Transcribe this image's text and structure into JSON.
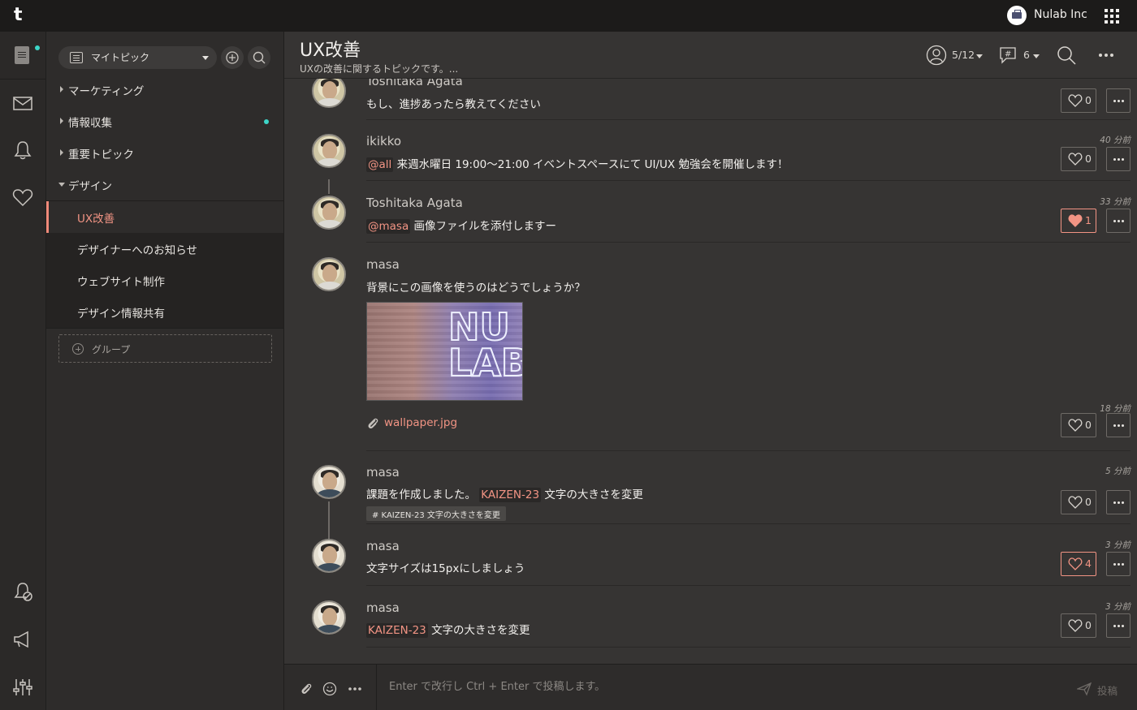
{
  "topbar": {
    "logo": "t",
    "org_name": "Nulab Inc"
  },
  "sidebar": {
    "topic_filter": "マイトピック",
    "groups": [
      {
        "label": "マーケティング",
        "expanded": false,
        "unread": false
      },
      {
        "label": "情報収集",
        "expanded": false,
        "unread": true
      },
      {
        "label": "重要トピック",
        "expanded": false,
        "unread": false
      },
      {
        "label": "デザイン",
        "expanded": true,
        "unread": false
      }
    ],
    "design_topics": [
      {
        "label": "UX改善",
        "active": true
      },
      {
        "label": "デザイナーへのお知らせ",
        "active": false
      },
      {
        "label": "ウェブサイト制作",
        "active": false
      },
      {
        "label": "デザイン情報共有",
        "active": false
      }
    ],
    "add_group": "グループ"
  },
  "header": {
    "title": "UX改善",
    "description": "UXの改善に関するトピックです。...",
    "members": "5/12",
    "tags": "6"
  },
  "messages": [
    {
      "author": "Toshitaka Agata",
      "text": "もし、進捗あったら教えてください",
      "likes": "0",
      "liked": false
    },
    {
      "author": "ikikko",
      "time": "40 分前",
      "mention": "@all",
      "text": "来週水曜日 19:00〜21:00 イベントスペースにて UI/UX 勉強会を開催します！",
      "likes": "0",
      "liked": false
    },
    {
      "author": "Toshitaka Agata",
      "time": "33 分前",
      "mention": "@masa",
      "text": "画像ファイルを添付しますー",
      "likes": "1",
      "liked": true
    },
    {
      "author": "masa",
      "time": "18 分前",
      "text": "背景にこの画像を使うのはどうでしょうか？",
      "attachment": "wallpaper.jpg",
      "likes": "0",
      "liked": false
    },
    {
      "author": "masa",
      "time": "5 分前",
      "text": "課題を作成しました。",
      "mention": "KAIZEN-23",
      "text2": "文字の大きさを変更",
      "tag": "# KAIZEN-23 文字の大きさを変更",
      "likes": "0",
      "liked": false
    },
    {
      "author": "masa",
      "time": "3 分前",
      "text": "文字サイズは15pxにしましょう",
      "likes": "4",
      "liked": false,
      "highlighted": true
    },
    {
      "author": "masa",
      "time": "3 分前",
      "mention": "KAIZEN-23",
      "text": "文字の大きさを変更",
      "likes": "0",
      "liked": false
    }
  ],
  "composer": {
    "placeholder": "Enter で改行し Ctrl + Enter で投稿します。",
    "post_label": "投稿"
  },
  "colors": {
    "accent": "#f29484",
    "unread_dot": "#3dd6c8",
    "background": "#363433"
  }
}
